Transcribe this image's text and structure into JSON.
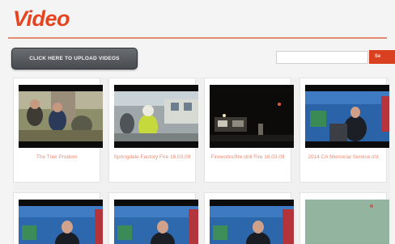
{
  "header": {
    "title": "Video"
  },
  "toolbar": {
    "upload_label": "CLICK HERE TO UPLOAD VIDEOS",
    "search_placeholder": "",
    "search_label": "Se"
  },
  "videos": [
    {
      "caption": "The Trek Prodom"
    },
    {
      "caption": "Springdale Factory Fire 16.03.09"
    },
    {
      "caption": "Fireworks/fire drill Fire 16.03.09"
    },
    {
      "caption": "2014 CA Memorial Service d'd"
    },
    {
      "caption": ""
    },
    {
      "caption": ""
    },
    {
      "caption": ""
    },
    {
      "caption": ""
    }
  ],
  "colors": {
    "accent": "#e8431f",
    "caption": "#ee8a73",
    "button_dark": "#484b50"
  }
}
